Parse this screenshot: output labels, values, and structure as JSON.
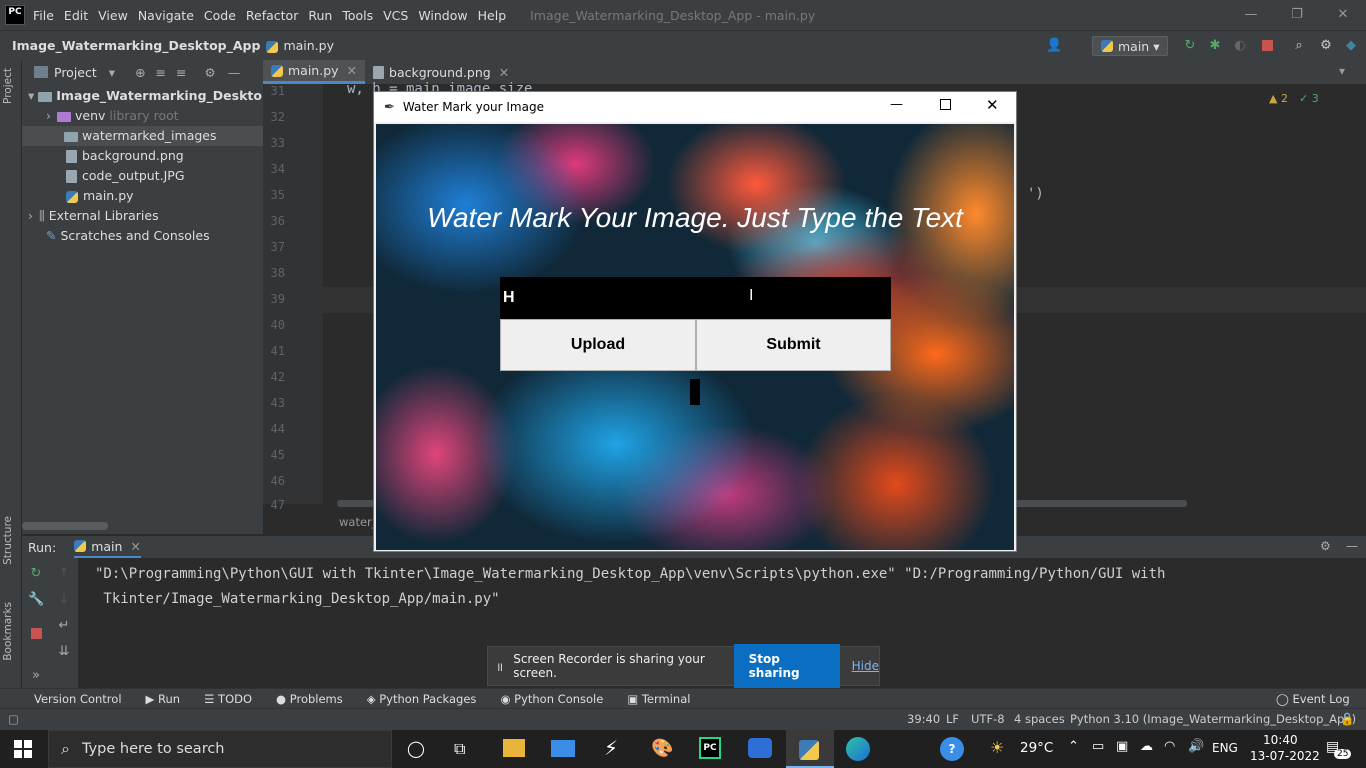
{
  "ide": {
    "title": "Image_Watermarking_Desktop_App - main.py",
    "menu": [
      "File",
      "Edit",
      "View",
      "Navigate",
      "Code",
      "Refactor",
      "Run",
      "Tools",
      "VCS",
      "Window",
      "Help"
    ],
    "breadcrumb": [
      "Image_Watermarking_Desktop_App",
      "main.py"
    ],
    "run_config": "main",
    "logo": "PC"
  },
  "project": {
    "header": "Project",
    "tree": [
      {
        "label": "Image_Watermarking_Desktop_App",
        "type": "folder"
      },
      {
        "label": "venv",
        "sub": "library root",
        "type": "folder"
      },
      {
        "label": "watermarked_images",
        "type": "folder"
      },
      {
        "label": "background.png",
        "type": "file"
      },
      {
        "label": "code_output.JPG",
        "type": "file"
      },
      {
        "label": "main.py",
        "type": "py"
      },
      {
        "label": "External Libraries",
        "type": "lib"
      },
      {
        "label": "Scratches and Consoles",
        "type": "lib"
      }
    ]
  },
  "side_tabs": {
    "project": "Project",
    "structure": "Structure",
    "bookmarks": "Bookmarks"
  },
  "editor": {
    "tabs": [
      "main.py",
      "background.png"
    ],
    "line_numbers": [
      "31",
      "32",
      "33",
      "34",
      "35",
      "36",
      "37",
      "38",
      "39",
      "40",
      "41",
      "42",
      "43",
      "44",
      "45",
      "46",
      "47"
    ],
    "code_top": "w, h = main_image.size",
    "code_frag": "')",
    "inspections": {
      "warnings": "2",
      "checks": "3"
    },
    "breadcrumb_bottom": "water_"
  },
  "run": {
    "label": "Run:",
    "config": "main",
    "command_line1": "\"D:\\Programming\\Python\\GUI with Tkinter\\Image_Watermarking_Desktop_App\\venv\\Scripts\\python.exe\" \"D:/Programming/Python/GUI with",
    "command_line2": " Tkinter/Image_Watermarking_Desktop_App/main.py\""
  },
  "bottom_tabs": [
    "Version Control",
    "Run",
    "TODO",
    "Problems",
    "Python Packages",
    "Python Console",
    "Terminal"
  ],
  "event_log": "Event Log",
  "status": {
    "position": "39:40",
    "eol": "LF",
    "encoding": "UTF-8",
    "indent": "4 spaces",
    "interpreter": "Python 3.10 (Image_Watermarking_Desktop_App)"
  },
  "app": {
    "window_title": "Water Mark your Image",
    "heading": "Water Mark Your Image. Just Type the Text",
    "input_value": "H",
    "upload_label": "Upload",
    "submit_label": "Submit"
  },
  "toast": {
    "message": "Screen Recorder is sharing your screen.",
    "stop": "Stop sharing",
    "hide": "Hide"
  },
  "taskbar": {
    "search_placeholder": "Type here to search",
    "weather": "29°C",
    "lang": "ENG",
    "time": "10:40",
    "date": "13-07-2022",
    "notifications": "25"
  }
}
